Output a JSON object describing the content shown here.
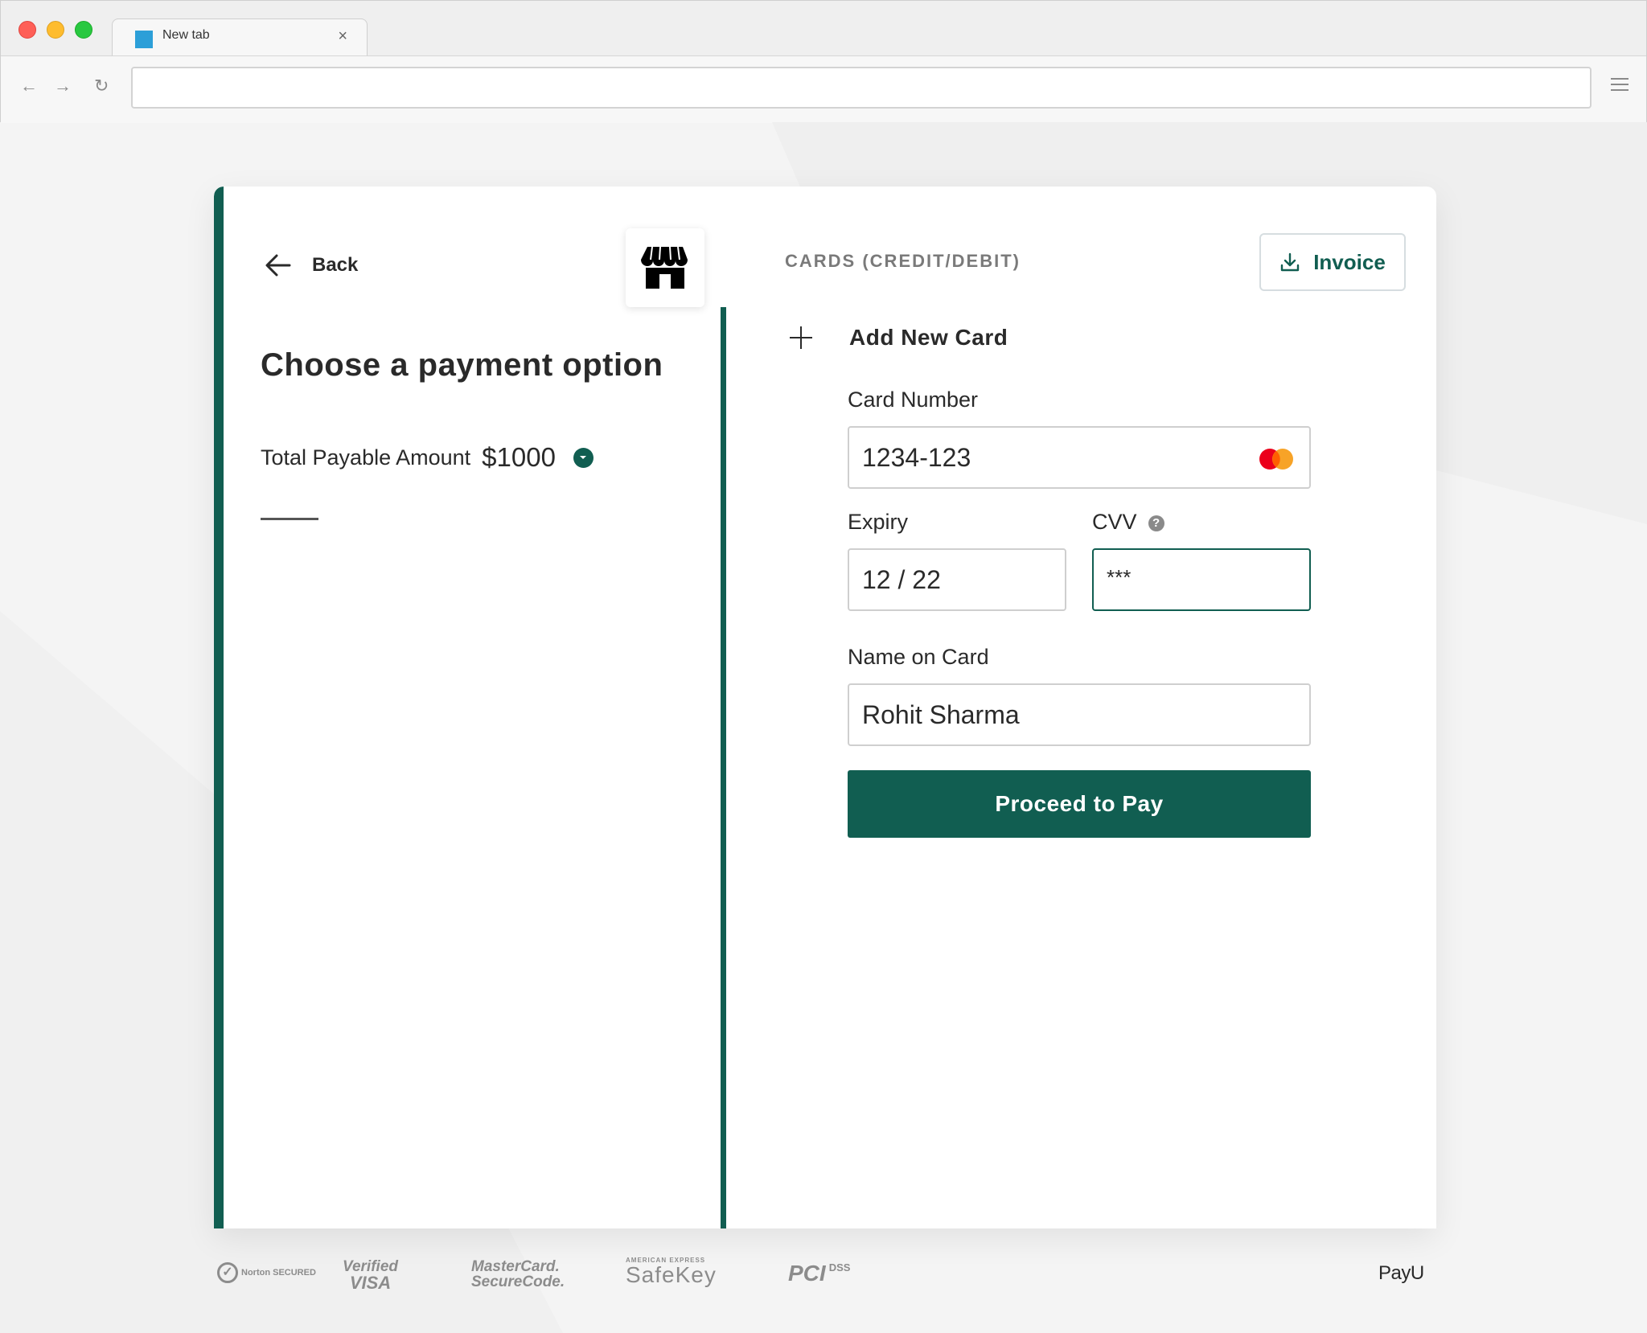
{
  "browser": {
    "tab_title": "New tab",
    "tab_close": "×",
    "url": "",
    "nav": {
      "back": "←",
      "forward": "→",
      "reload": "↻"
    }
  },
  "left": {
    "back_label": "Back",
    "heading": "Choose a payment option",
    "amount_label": "Total Payable Amount",
    "amount_value": "$1000"
  },
  "right": {
    "section_title": "CARDS (CREDIT/DEBIT)",
    "invoice_label": "Invoice",
    "add_card_label": "Add New Card",
    "card_number_label": "Card Number",
    "card_number_value": "1234-123",
    "expiry_label": "Expiry",
    "expiry_value": "12 / 22",
    "cvv_label": "CVV",
    "cvv_help": "?",
    "cvv_value": "***",
    "name_label": "Name on Card",
    "name_value": "Rohit Sharma",
    "pay_button": "Proceed to Pay"
  },
  "footer": {
    "norton_check": "✓",
    "norton": "Norton SECURED",
    "visa_top": "Verified",
    "visa_bottom": "VISA",
    "mc_top": "MasterCard.",
    "mc_bottom": "SecureCode.",
    "amex_small": "AMERICAN EXPRESS",
    "safekey": "SafeKey",
    "pci": "PCI",
    "dss": "DSS",
    "payu": "PayU"
  },
  "colors": {
    "accent": "#115e51",
    "mastercard_red": "#eb001b",
    "mastercard_orange": "#f79e1b"
  }
}
